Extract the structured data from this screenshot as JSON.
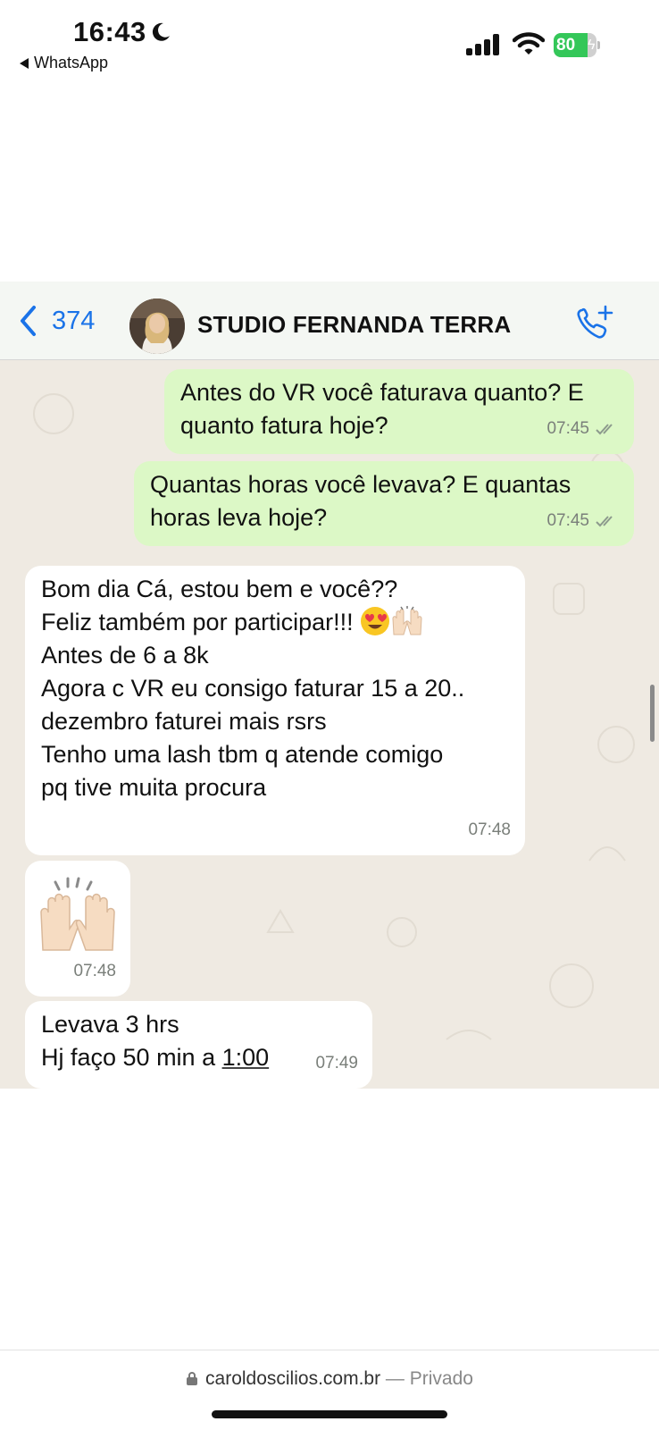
{
  "status_bar": {
    "time": "16:43",
    "back_app": "WhatsApp",
    "battery": "80",
    "battery_level": 0.8,
    "icons": [
      "moon-icon",
      "signal-icon",
      "wifi-icon",
      "battery-icon"
    ]
  },
  "header": {
    "back_count": "374",
    "contact_name": "STUDIO FERNANDA TERRA",
    "icons": [
      "chevron-left-icon",
      "add-call-icon"
    ]
  },
  "messages": [
    {
      "direction": "out",
      "text": "Antes do VR você faturava quanto? E\nquanto fatura hoje?",
      "time": "07:45",
      "read": true
    },
    {
      "direction": "out",
      "text": "Quantas horas você levava? E quantas\nhoras leva hoje?",
      "time": "07:45",
      "read": true
    },
    {
      "direction": "in",
      "line1": "Bom dia Cá, estou bem e você??",
      "line2": "Feliz também por participar!!! ",
      "emojis": [
        "😍",
        "🙌"
      ],
      "rest": "\nAntes de 6 a 8k\nAgora c VR eu consigo faturar 15 a 20..\ndezembro faturei mais rsrs\nTenho uma lash tbm q atende comigo\npq tive muita procura",
      "time": "07:48"
    },
    {
      "direction": "in",
      "emoji": "🙌",
      "time": "07:48"
    },
    {
      "direction": "in",
      "line1": "Levava 3 hrs",
      "line2_prefix": "Hj faço 50 min a ",
      "line2_link": "1:00",
      "time": "07:49"
    }
  ],
  "footer": {
    "domain": "caroldoscilios.com.br",
    "separator": " — ",
    "privacy": "Privado"
  },
  "colors": {
    "accent": "#1a73e8",
    "outgoing_bubble": "#dcf8c6",
    "incoming_bubble": "#ffffff",
    "chat_background": "#efeae2",
    "battery": "#34c759",
    "read_ticks": "#8d9a8d"
  }
}
